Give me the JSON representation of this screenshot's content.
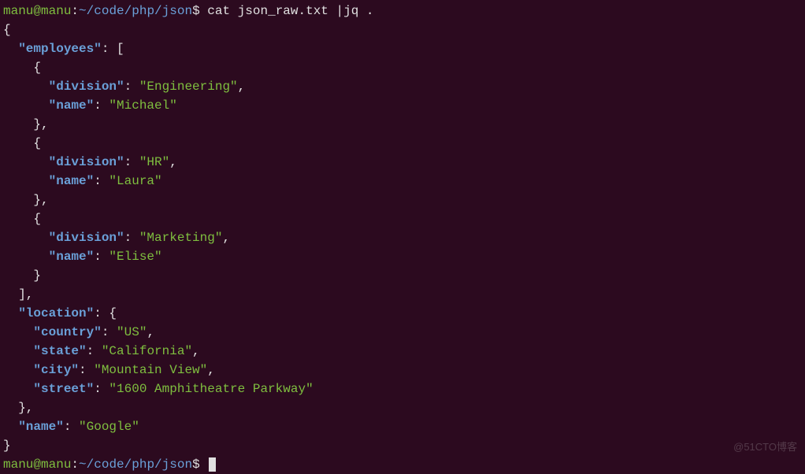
{
  "prompt": {
    "user": "manu@manu",
    "colon": ":",
    "tilde": "~",
    "path": "/code/php/json",
    "dollar": "$"
  },
  "command": "cat json_raw.txt |jq .",
  "json": {
    "open_brace": "{",
    "employees_key": "\"employees\"",
    "open_bracket": "[",
    "emp1_open": "{",
    "emp1_div_key": "\"division\"",
    "emp1_div_val": "\"Engineering\"",
    "emp1_name_key": "\"name\"",
    "emp1_name_val": "\"Michael\"",
    "emp1_close": "},",
    "emp2_open": "{",
    "emp2_div_key": "\"division\"",
    "emp2_div_val": "\"HR\"",
    "emp2_name_key": "\"name\"",
    "emp2_name_val": "\"Laura\"",
    "emp2_close": "},",
    "emp3_open": "{",
    "emp3_div_key": "\"division\"",
    "emp3_div_val": "\"Marketing\"",
    "emp3_name_key": "\"name\"",
    "emp3_name_val": "\"Elise\"",
    "emp3_close": "}",
    "close_bracket": "],",
    "location_key": "\"location\"",
    "loc_open": "{",
    "country_key": "\"country\"",
    "country_val": "\"US\"",
    "state_key": "\"state\"",
    "state_val": "\"California\"",
    "city_key": "\"city\"",
    "city_val": "\"Mountain View\"",
    "street_key": "\"street\"",
    "street_val": "\"1600 Amphitheatre Parkway\"",
    "loc_close": "},",
    "name_key": "\"name\"",
    "name_val": "\"Google\"",
    "close_brace": "}"
  },
  "watermark": "@51CTO博客"
}
